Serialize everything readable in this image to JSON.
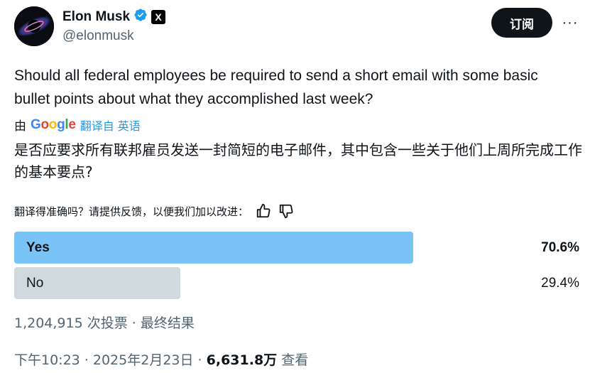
{
  "author": {
    "display_name": "Elon Musk",
    "handle": "@elonmusk",
    "verified_icon": "verified-badge-icon",
    "affiliate_badge": "X"
  },
  "actions": {
    "follow_label": "订阅",
    "more_label": "···"
  },
  "tweet": {
    "text": "Should all federal employees be required to send a short email with some basic bullet points about what they accomplished last week?"
  },
  "translation": {
    "by_label": "由",
    "provider": "Google",
    "link_label": "翻译自 英语",
    "translated_text": "是否应要求所有联邦雇员发送一封简短的电子邮件，其中包含一些关于他们上周所完成工作的基本要点?",
    "feedback_prompt": "翻译得准确吗？请提供反馈，以便我们加以改进："
  },
  "poll": {
    "options": [
      {
        "label": "Yes",
        "percent_text": "70.6%",
        "fraction": 0.706,
        "winner": true
      },
      {
        "label": "No",
        "percent_text": "29.4%",
        "fraction": 0.294,
        "winner": false
      }
    ],
    "meta": "1,204,915 次投票 · 最终结果"
  },
  "footer": {
    "time": "下午10:23 · 2025年2月23日 · ",
    "views": "6,631.8万",
    "views_suffix": " 查看"
  },
  "colors": {
    "accent": "#1d9bf0",
    "winner_bar": "#79c3f7",
    "loser_bar": "#cfd9de",
    "muted_text": "#536471"
  }
}
